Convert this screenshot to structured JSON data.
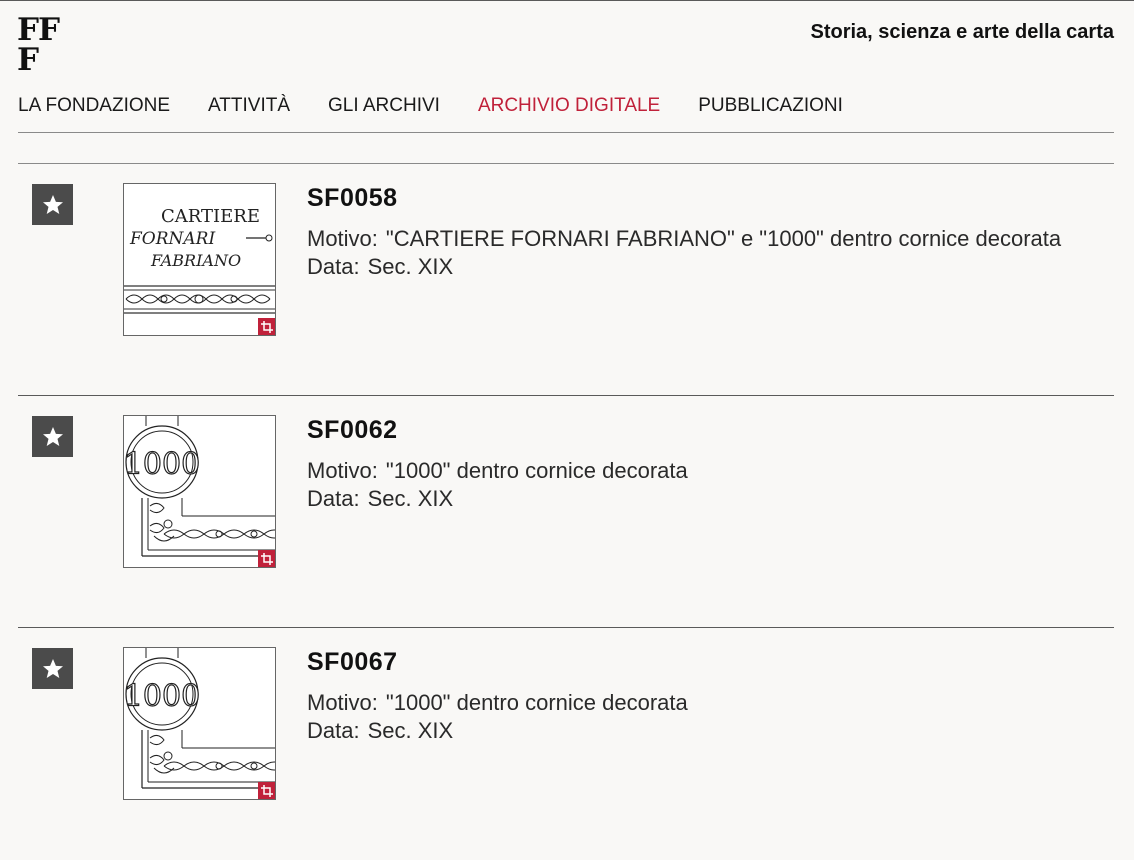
{
  "header": {
    "logo_line1": "FF",
    "logo_line2": "F",
    "tagline": "Storia, scienza e arte della carta"
  },
  "nav": {
    "items": [
      {
        "label": "LA FONDAZIONE"
      },
      {
        "label": "ATTIVITÀ"
      },
      {
        "label": "GLI ARCHIVI"
      },
      {
        "label": "ARCHIVIO DIGITALE",
        "active": true
      },
      {
        "label": "PUBBLICAZIONI"
      }
    ]
  },
  "colors": {
    "accent": "#c0213a",
    "button_bg": "#4b4b4b",
    "background": "#f9f8f6"
  },
  "records": [
    {
      "id": "SF0058",
      "motivo_label": "Motivo:",
      "motivo": "\"CARTIERE FORNARI FABRIANO\" e \"1000\" dentro cornice decorata",
      "data_label": "Data:",
      "data": "Sec. XIX",
      "thumb_icon": "watermark-cartiere-fornari-image",
      "thumb_text": [
        "CARTIERE",
        "FORNARI",
        "FABRIANO"
      ]
    },
    {
      "id": "SF0062",
      "motivo_label": "Motivo:",
      "motivo": "\"1000\" dentro cornice decorata",
      "data_label": "Data:",
      "data": "Sec. XIX",
      "thumb_icon": "watermark-1000-image",
      "thumb_text": [
        "1000"
      ]
    },
    {
      "id": "SF0067",
      "motivo_label": "Motivo:",
      "motivo": "\"1000\" dentro cornice decorata",
      "data_label": "Data:",
      "data": "Sec. XIX",
      "thumb_icon": "watermark-1000-image",
      "thumb_text": [
        "1000"
      ]
    }
  ],
  "icons": {
    "favorite": "star-icon",
    "crop": "crop-icon"
  }
}
